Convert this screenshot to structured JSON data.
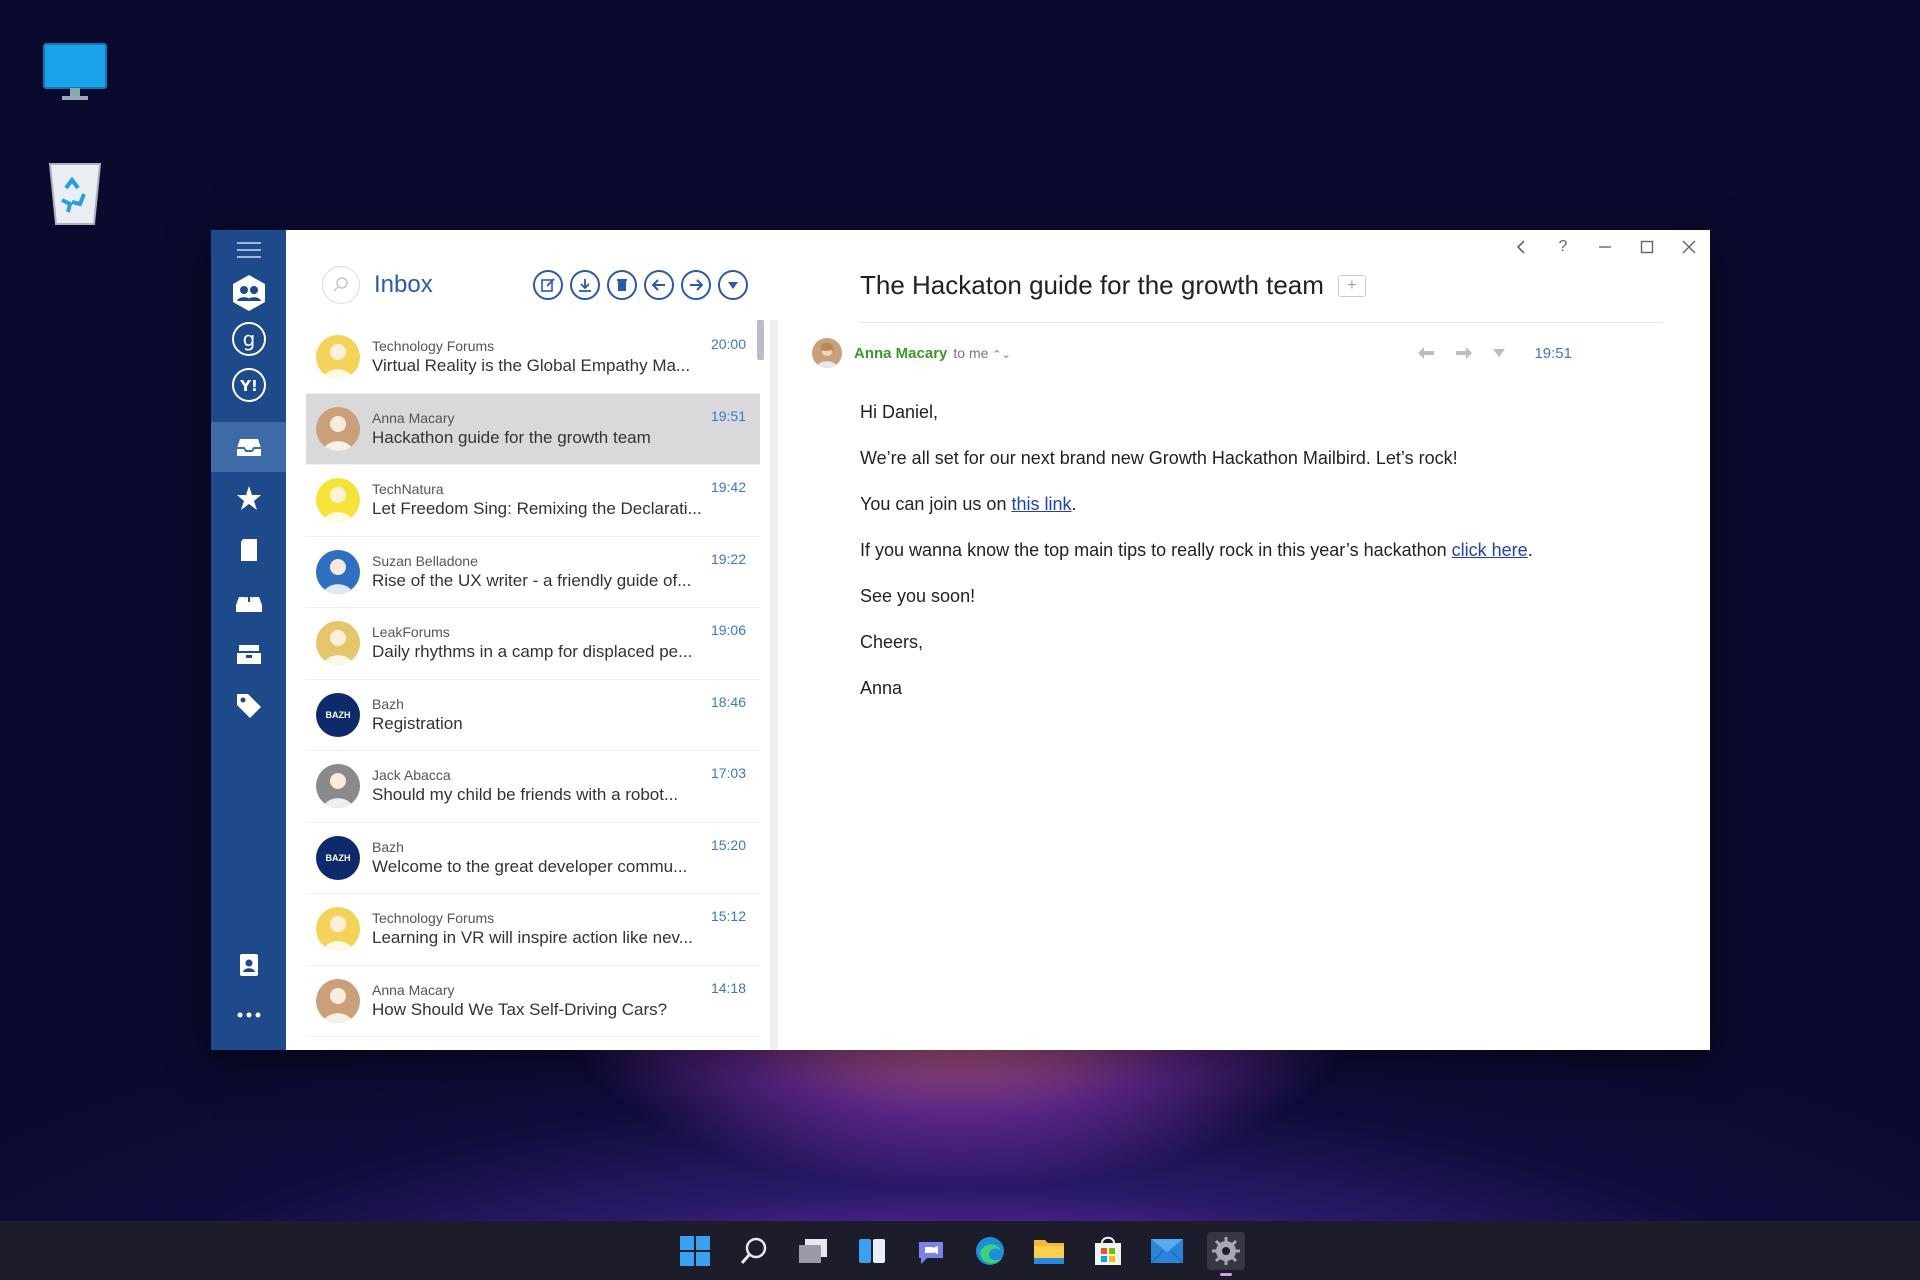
{
  "desktop": {
    "icons": [
      "this-pc-icon",
      "recycle-bin-icon"
    ]
  },
  "window": {
    "controls": [
      "back-icon",
      "help-icon",
      "minimize-icon",
      "maximize-icon",
      "close-icon"
    ],
    "help_glyph": "?"
  },
  "sidebar": {
    "items": [
      {
        "name": "menu-icon"
      },
      {
        "name": "all-accounts-icon"
      },
      {
        "name": "google-account-icon"
      },
      {
        "name": "yahoo-account-icon"
      },
      {
        "name": "inbox-icon",
        "active": true
      },
      {
        "name": "starred-icon"
      },
      {
        "name": "drafts-icon"
      },
      {
        "name": "sent-icon"
      },
      {
        "name": "archive-icon"
      },
      {
        "name": "tags-icon"
      },
      {
        "name": "contacts-icon"
      },
      {
        "name": "more-icon"
      }
    ],
    "google_glyph": "g",
    "yahoo_glyph": "Y!"
  },
  "list": {
    "title": "Inbox",
    "toolbar": [
      "compose-icon",
      "download-icon",
      "delete-icon",
      "reply-icon",
      "forward-icon",
      "more-down-icon"
    ],
    "messages": [
      {
        "from": "Technology Forums",
        "subject": "Virtual Reality is the Global Empathy Ma...",
        "time": "20:00",
        "avatar_color": "#f3d35a"
      },
      {
        "from": "Anna Macary",
        "subject": "Hackathon guide for the growth team",
        "time": "19:51",
        "avatar_color": "#c9a07a",
        "selected": true
      },
      {
        "from": "TechNatura",
        "subject": "Let Freedom Sing: Remixing the Declarati...",
        "time": "19:42",
        "avatar_color": "#f5e33a"
      },
      {
        "from": "Suzan Belladone",
        "subject": "Rise of the UX writer - a friendly guide of...",
        "time": "19:22",
        "avatar_color": "#2f6fc0"
      },
      {
        "from": "LeakForums",
        "subject": "Daily rhythms in a camp for displaced pe...",
        "time": "19:06",
        "avatar_color": "#e6c66a"
      },
      {
        "from": "Bazh",
        "subject": "Registration",
        "time": "18:46",
        "avatar_color": "#0f2a6a",
        "badge": "BAZH"
      },
      {
        "from": "Jack Abacca",
        "subject": "Should my child be friends with a robot...",
        "time": "17:03",
        "avatar_color": "#8a8a8a"
      },
      {
        "from": "Bazh",
        "subject": "Welcome to the great developer commu...",
        "time": "15:20",
        "avatar_color": "#0f2a6a",
        "badge": "BAZH"
      },
      {
        "from": "Technology Forums",
        "subject": "Learning in VR will inspire action like nev...",
        "time": "15:12",
        "avatar_color": "#f3d35a"
      },
      {
        "from": "Anna Macary",
        "subject": "How Should We Tax Self-Driving Cars?",
        "time": "14:18",
        "avatar_color": "#c9a07a"
      }
    ]
  },
  "reader": {
    "subject": "The Hackaton guide for the growth team",
    "tag_glyph": "+",
    "sender": "Anna Macary",
    "to": "to me",
    "to_chevron": "⌃⌄",
    "time": "19:51",
    "actions": [
      "reply-icon",
      "forward-icon",
      "more-down-icon"
    ],
    "body": {
      "greeting": "Hi Daniel,",
      "line1": "We’re all set for our next brand new Growth Hackathon Mailbird. Let’s rock!",
      "line2_prefix": "You can join us on ",
      "line2_link": "this link",
      "line2_suffix": ".",
      "line3_prefix": "If you wanna know the top main tips to really rock in this year’s hackathon ",
      "line3_link": "click here",
      "line3_suffix": ".",
      "line4": "See you soon!",
      "line5": "Cheers,",
      "signature": "Anna"
    }
  },
  "taskbar": {
    "icons": [
      "start-icon",
      "search-icon",
      "task-view-icon",
      "widgets-icon",
      "chat-icon",
      "edge-icon",
      "file-explorer-icon",
      "store-icon",
      "mail-icon",
      "settings-icon"
    ]
  },
  "colors": {
    "sidebar": "#1e4a8c",
    "accent": "#2a5aa8",
    "sender": "#3a9a2a",
    "time": "#3a78c5",
    "link": "#2042a8"
  }
}
